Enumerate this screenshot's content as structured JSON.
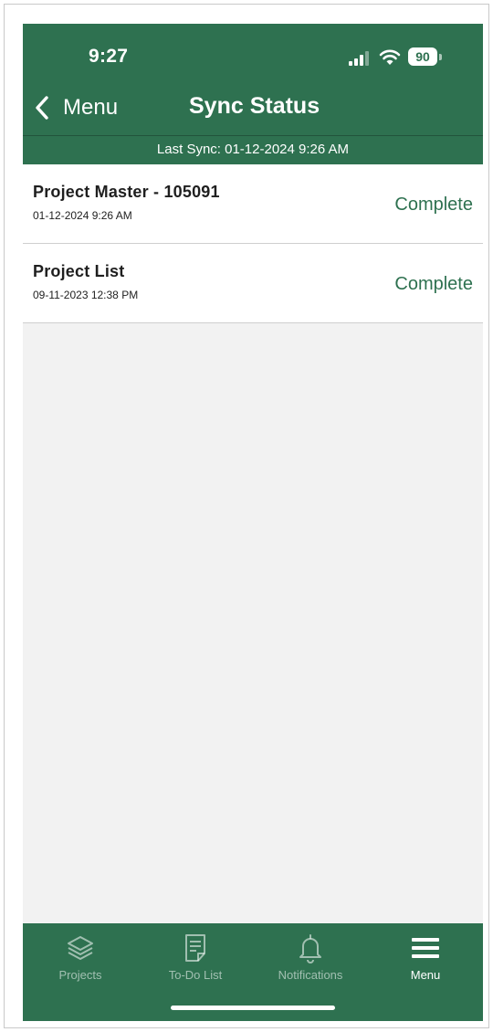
{
  "status_bar": {
    "time": "9:27",
    "battery_level": "90"
  },
  "nav": {
    "back_label": "Menu",
    "title": "Sync Status"
  },
  "last_sync": "Last Sync: 01-12-2024 9:26 AM",
  "sync_items": [
    {
      "title": "Project Master - 105091",
      "date": "01-12-2024 9:26 AM",
      "status": "Complete"
    },
    {
      "title": "Project List",
      "date": "09-11-2023 12:38 PM",
      "status": "Complete"
    }
  ],
  "tabbar": {
    "tabs": [
      {
        "label": "Projects",
        "icon": "layers-icon",
        "active": false
      },
      {
        "label": "To-Do List",
        "icon": "document-icon",
        "active": false
      },
      {
        "label": "Notifications",
        "icon": "bell-icon",
        "active": false
      },
      {
        "label": "Menu",
        "icon": "hamburger-menu-icon",
        "active": true
      }
    ]
  },
  "colors": {
    "brand_green": "#2e7150",
    "background": "#f2f2f2",
    "status_complete": "#2e7150"
  }
}
